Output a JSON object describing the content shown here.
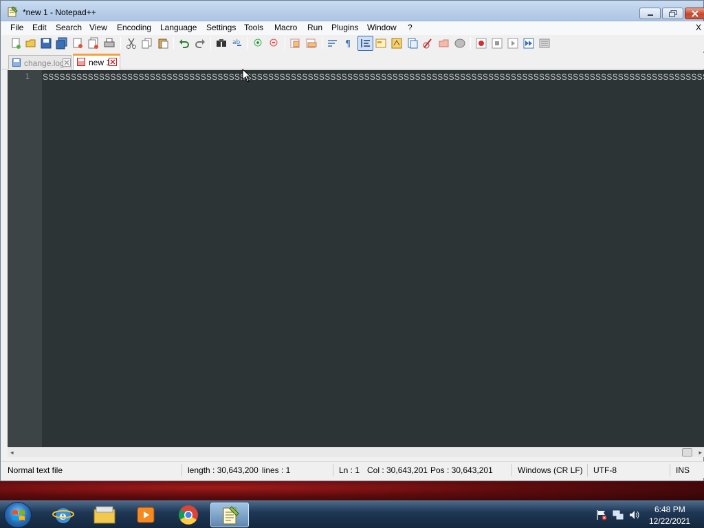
{
  "window": {
    "title": "*new 1 - Notepad++"
  },
  "menu": {
    "items": [
      "File",
      "Edit",
      "Search",
      "View",
      "Encoding",
      "Language",
      "Settings",
      "Tools",
      "Macro",
      "Run",
      "Plugins",
      "Window",
      "?"
    ],
    "close_label": "X"
  },
  "tabs": [
    {
      "label": "change.log",
      "active": false
    },
    {
      "label": "new 1",
      "active": true
    }
  ],
  "editor": {
    "line_number": "1",
    "line_text": "SSSSSSSSSSSSSSSSSSSSSSSSSSSSSSSSSSSSSSSSSSSSSSSSSSSSSSSSSSSSSSSSSSSSSSSSSSSSSSSSSSSSSSSSSSSSSSSSSSSSSSSSSSSSSSSSSSSSSSSSSSSSSSSSSSSSSSSSSSSSSSSSSSSSSSSSSSSSSSSSSSSSSSSSSSS"
  },
  "statusbar": {
    "file_type": "Normal text file",
    "length": "length : 30,643,200",
    "lines": "lines : 1",
    "ln": "Ln : 1",
    "col": "Col : 30,643,201",
    "pos": "Pos : 30,643,201",
    "eol": "Windows (CR LF)",
    "encoding": "UTF-8",
    "mode": "INS"
  },
  "taskbar": {
    "apps": [
      "internet-explorer",
      "file-explorer",
      "media-player",
      "chrome",
      "notepad-plus-plus"
    ],
    "time": "6:48 PM",
    "date": "12/22/2021"
  },
  "colors": {
    "editor_bg": "#2c3435",
    "gutter_bg": "#3c4446",
    "text": "#c8cdd0",
    "active_tab_accent": "#f6a23c"
  }
}
